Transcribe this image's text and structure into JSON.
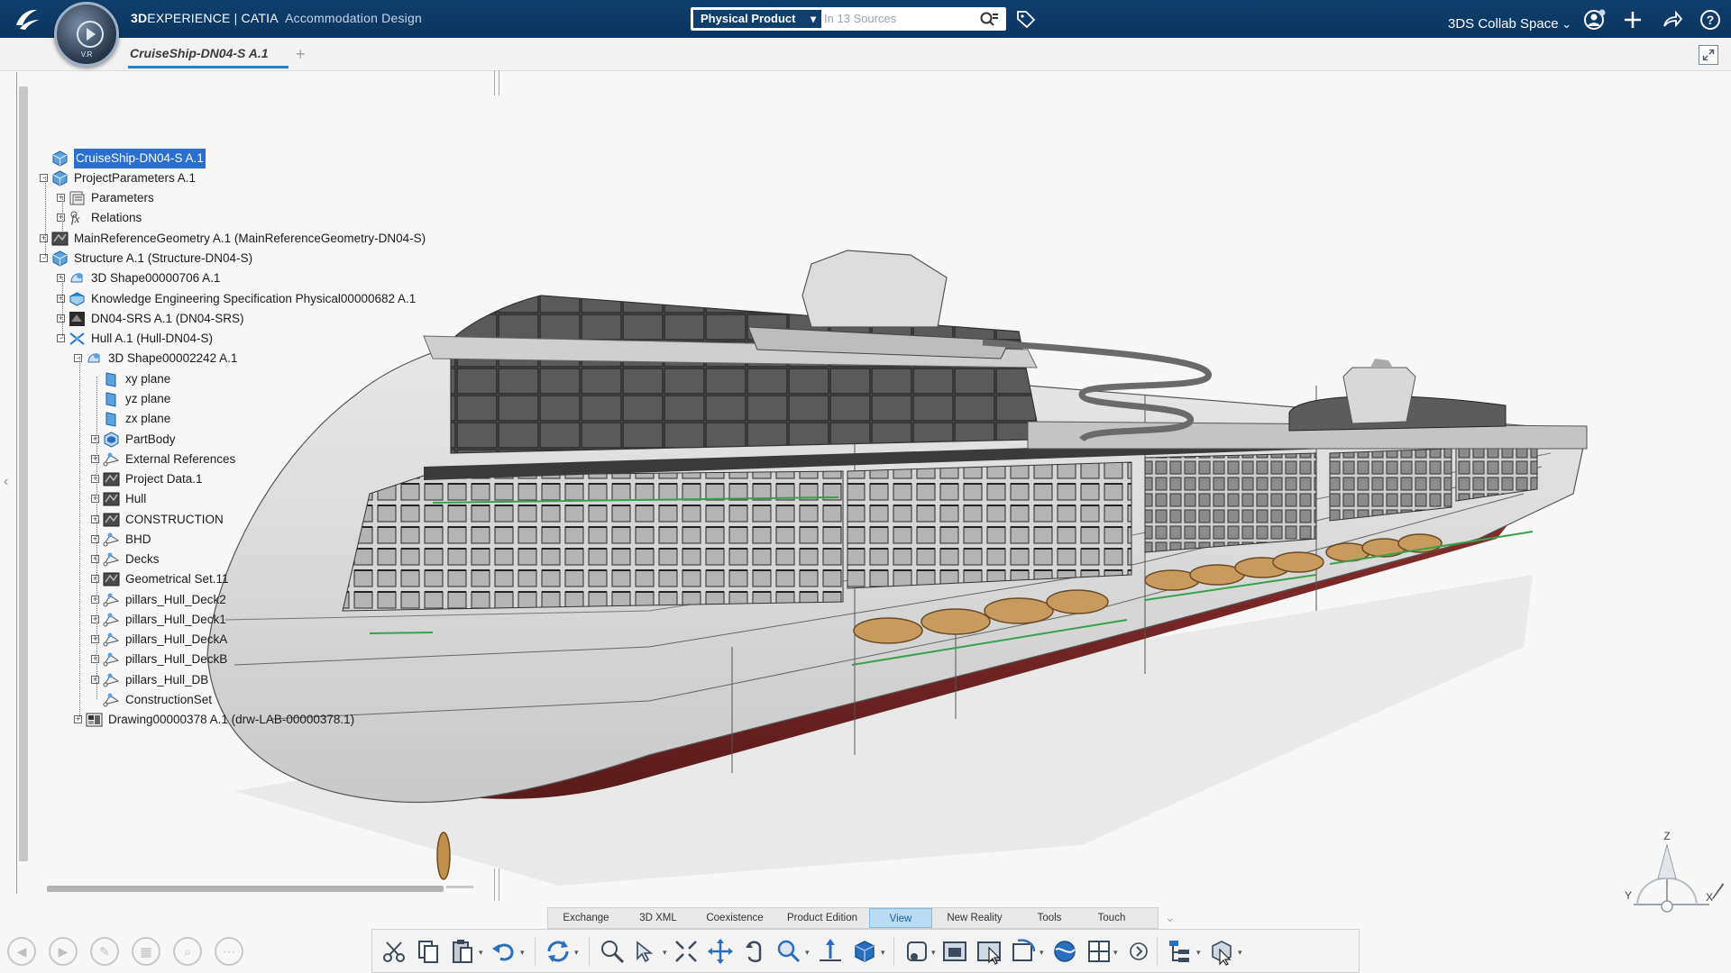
{
  "header": {
    "brand_bold": "3D",
    "brand_rest": "EXPERIENCE | CATIA",
    "app_name": "Accommodation Design",
    "compass_version": "V.R",
    "search_scope": "Physical Product",
    "search_placeholder": "In 13 Sources",
    "collab_space": "3DS Collab Space"
  },
  "tabs": [
    {
      "label": "CruiseShip-DN04-S A.1"
    }
  ],
  "tabs_add": "+",
  "tree": [
    {
      "label": "CruiseShip-DN04-S A.1",
      "icon": "product-icon",
      "selected": true
    },
    {
      "label": "ProjectParameters A.1",
      "icon": "product-icon"
    },
    {
      "label": "Parameters",
      "icon": "parameters-icon"
    },
    {
      "label": "Relations",
      "icon": "relations-icon"
    },
    {
      "label": "MainReferenceGeometry A.1 (MainReferenceGeometry-DN04-S)",
      "icon": "geometry-icon"
    },
    {
      "label": "Structure A.1 (Structure-DN04-S)",
      "icon": "product-icon"
    },
    {
      "label": "3D Shape00000706 A.1",
      "icon": "shape-icon"
    },
    {
      "label": "Knowledge Engineering Specification Physical00000682 A.1",
      "icon": "knowledge-icon"
    },
    {
      "label": "DN04-SRS A.1 (DN04-SRS)",
      "icon": "srs-icon"
    },
    {
      "label": "Hull A.1 (Hull-DN04-S)",
      "icon": "hull-icon"
    },
    {
      "label": "3D Shape00002242 A.1",
      "icon": "shape-icon"
    },
    {
      "label": "xy plane",
      "icon": "plane-icon"
    },
    {
      "label": "yz plane",
      "icon": "plane-icon"
    },
    {
      "label": "zx plane",
      "icon": "plane-icon"
    },
    {
      "label": "PartBody",
      "icon": "partbody-icon"
    },
    {
      "label": "External References",
      "icon": "geometrical-set-icon"
    },
    {
      "label": "Project Data.1",
      "icon": "geometry-icon"
    },
    {
      "label": "Hull",
      "icon": "geometry-icon"
    },
    {
      "label": "CONSTRUCTION",
      "icon": "geometry-icon"
    },
    {
      "label": "BHD",
      "icon": "geometrical-set-icon"
    },
    {
      "label": "Decks",
      "icon": "geometrical-set-icon"
    },
    {
      "label": "Geometrical Set.11",
      "icon": "geometry-icon"
    },
    {
      "label": "pillars_Hull_Deck2",
      "icon": "geometrical-set-icon"
    },
    {
      "label": "pillars_Hull_Deck1",
      "icon": "geometrical-set-icon"
    },
    {
      "label": "pillars_Hull_DeckA",
      "icon": "geometrical-set-icon"
    },
    {
      "label": "pillars_Hull_DeckB",
      "icon": "geometrical-set-icon"
    },
    {
      "label": "pillars_Hull_DB",
      "icon": "geometrical-set-icon"
    },
    {
      "label": "ConstructionSet",
      "icon": "geometrical-set-icon"
    },
    {
      "label": "Drawing00000378 A.1 (drw-LAB-00000378.1)",
      "icon": "drawing-icon"
    }
  ],
  "section_tabs": [
    "Exchange",
    "3D XML",
    "Coexistence",
    "Product Edition",
    "View",
    "New Reality",
    "Tools",
    "Touch"
  ],
  "active_section": "View",
  "axis_labels": {
    "z": "Z",
    "y": "Y",
    "x": "X"
  },
  "colors": {
    "header_bg": "#0f3f6d",
    "selection": "#2a6fd0",
    "active_tab_bg": "#b9dcf5",
    "hull_red": "#7a2626"
  }
}
